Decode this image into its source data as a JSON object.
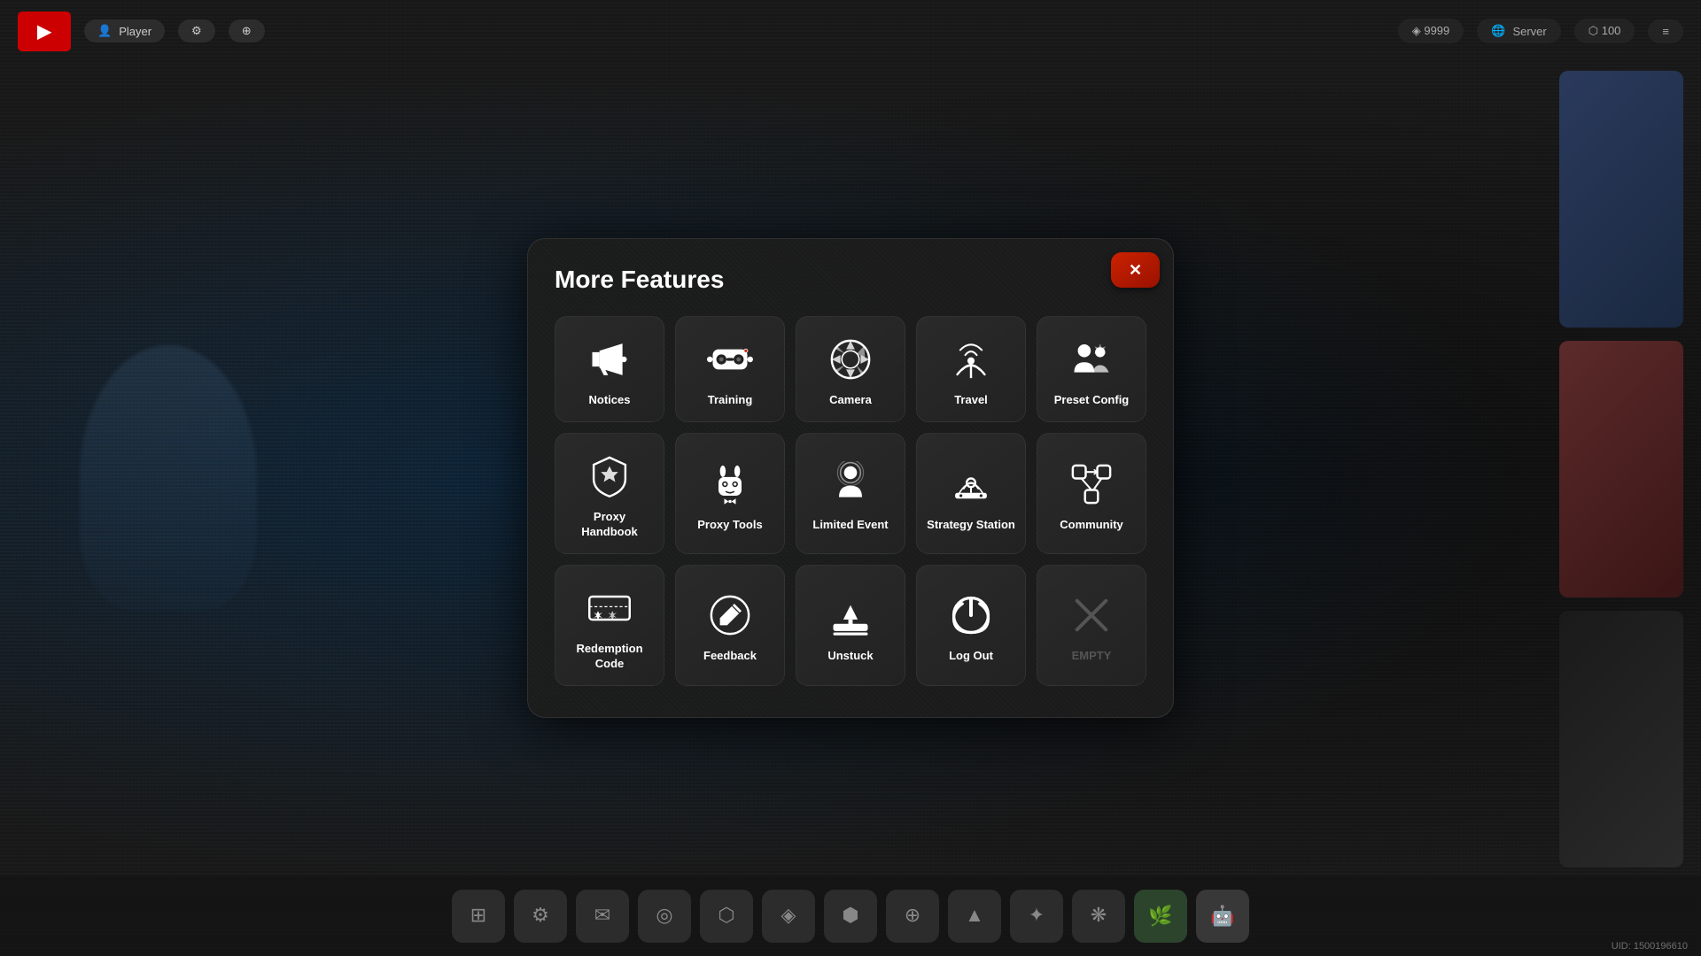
{
  "modal": {
    "title": "More Features",
    "close_label": "✕"
  },
  "features": [
    {
      "id": "notices",
      "label": "Notices",
      "icon": "megaphone",
      "row": 1
    },
    {
      "id": "training",
      "label": "Training",
      "icon": "vr",
      "row": 1
    },
    {
      "id": "camera",
      "label": "Camera",
      "icon": "camera",
      "row": 1
    },
    {
      "id": "travel",
      "label": "Travel",
      "icon": "wifi-broadcast",
      "row": 1
    },
    {
      "id": "preset-config",
      "label": "Preset Config",
      "icon": "users-gear",
      "row": 1
    },
    {
      "id": "proxy-handbook",
      "label": "Proxy Handbook",
      "icon": "shield-diamond",
      "row": 2
    },
    {
      "id": "proxy-tools",
      "label": "Proxy Tools",
      "icon": "robot-bunny",
      "row": 2
    },
    {
      "id": "limited-event",
      "label": "Limited Event",
      "icon": "user-target",
      "row": 2
    },
    {
      "id": "strategy-station",
      "label": "Strategy Station",
      "icon": "wifi-table",
      "row": 2
    },
    {
      "id": "community",
      "label": "Community",
      "icon": "community",
      "row": 2
    },
    {
      "id": "redemption-code",
      "label": "Redemption Code",
      "icon": "ticket",
      "row": 3
    },
    {
      "id": "feedback",
      "label": "Feedback",
      "icon": "pen-circle",
      "row": 3
    },
    {
      "id": "unstuck",
      "label": "Unstuck",
      "icon": "tray-up",
      "row": 3
    },
    {
      "id": "log-out",
      "label": "Log Out",
      "icon": "power",
      "row": 3
    },
    {
      "id": "empty",
      "label": "EMPTY",
      "icon": "x-mark",
      "row": 3,
      "empty": true
    }
  ],
  "uid": {
    "label": "UID: 1500196610"
  },
  "bottom_icons": [
    {
      "id": "icon1",
      "symbol": "⊞"
    },
    {
      "id": "icon2",
      "symbol": "⚙"
    },
    {
      "id": "icon3",
      "symbol": "✉"
    },
    {
      "id": "icon4",
      "symbol": "◎"
    },
    {
      "id": "icon5",
      "symbol": "⬡"
    },
    {
      "id": "icon6",
      "symbol": "◈"
    },
    {
      "id": "icon7",
      "symbol": "⬢"
    },
    {
      "id": "icon8",
      "symbol": "⊕"
    },
    {
      "id": "icon9",
      "symbol": "▲"
    },
    {
      "id": "icon10",
      "symbol": "✦"
    },
    {
      "id": "icon11",
      "symbol": "❋"
    },
    {
      "id": "icon12",
      "symbol": "🌿"
    },
    {
      "id": "icon13",
      "symbol": "🤖"
    }
  ]
}
